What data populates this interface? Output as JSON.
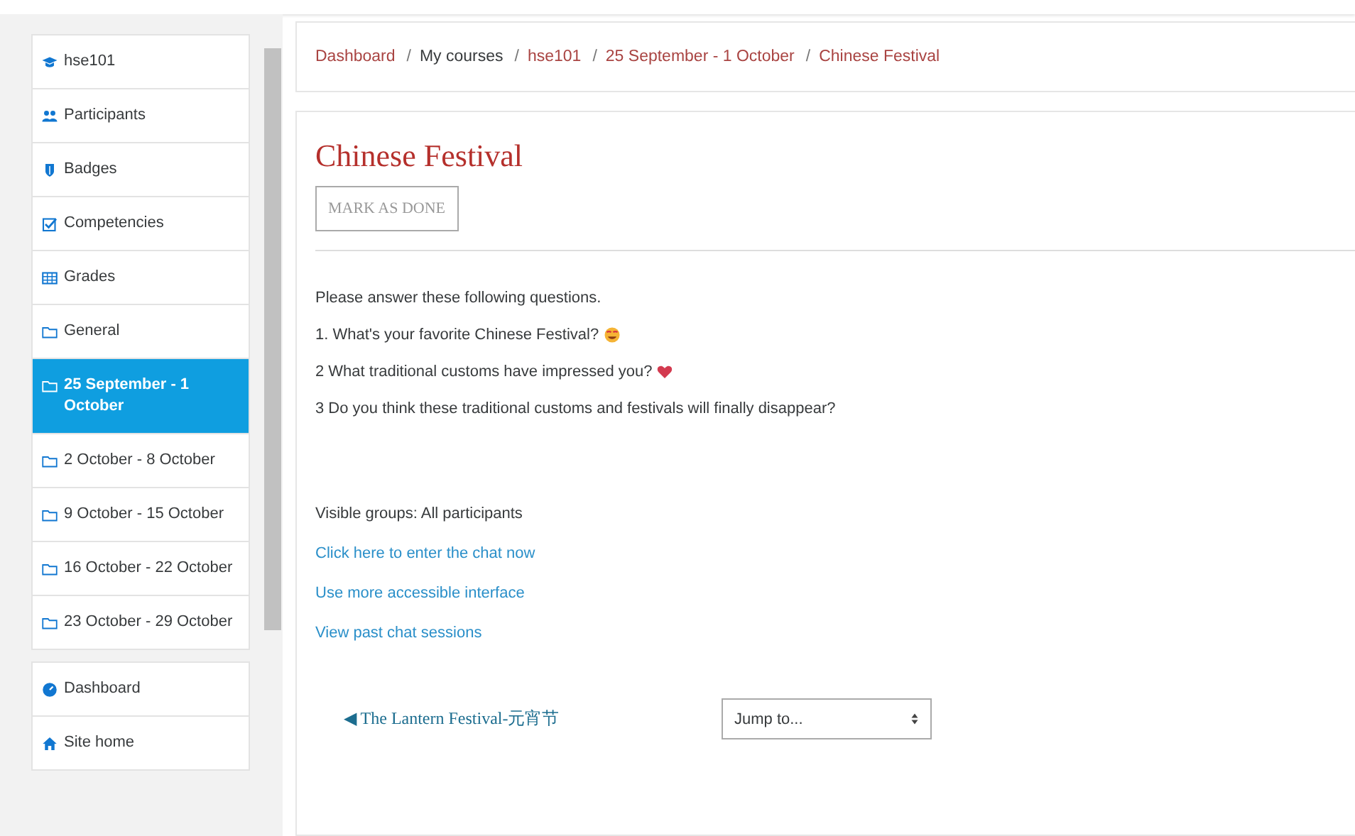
{
  "sidebar": {
    "groups": [
      {
        "items": [
          {
            "label": "hse101",
            "selected": false
          },
          {
            "label": "Participants",
            "selected": false
          },
          {
            "label": "Badges",
            "selected": false
          },
          {
            "label": "Competencies",
            "selected": false
          },
          {
            "label": "Grades",
            "selected": false
          },
          {
            "label": "General",
            "selected": false
          },
          {
            "label": "25 September - 1 October",
            "selected": true
          },
          {
            "label": "2 October - 8 October",
            "selected": false
          },
          {
            "label": "9 October - 15 October",
            "selected": false
          },
          {
            "label": "16 October - 22 October",
            "selected": false
          },
          {
            "label": "23 October - 29 October",
            "selected": false
          }
        ]
      },
      {
        "items": [
          {
            "label": "Dashboard",
            "selected": false
          },
          {
            "label": "Site home",
            "selected": false
          }
        ]
      }
    ]
  },
  "breadcrumb": [
    {
      "label": "Dashboard",
      "link": true
    },
    {
      "separator": "/",
      "label": "My courses",
      "link": false
    },
    {
      "separator": "/",
      "label": "hse101",
      "link": true
    },
    {
      "separator": "/",
      "label": "25 September - 1 October",
      "link": true
    },
    {
      "separator": "/",
      "label": "Chinese Festival",
      "link": true
    }
  ],
  "page": {
    "title": "Chinese Festival",
    "mark_button": "MARK AS DONE",
    "paragraphs": [
      {
        "text": "Please answer these following questions."
      },
      {
        "text": "1. What's your favorite Chinese Festival?"
      },
      {
        "text": "2 What traditional customs have impressed you? "
      },
      {
        "text": "3 Do you think these traditional customs and festivals will finally disappear?"
      }
    ],
    "groups_text": "Visible groups: All participants",
    "links": [
      "Click here to enter the chat now",
      "Use more accessible interface",
      "View past chat sessions"
    ],
    "prev_link": "◀ The Lantern Festival-元宵节",
    "jump": {
      "placeholder": "Jump to..."
    }
  }
}
